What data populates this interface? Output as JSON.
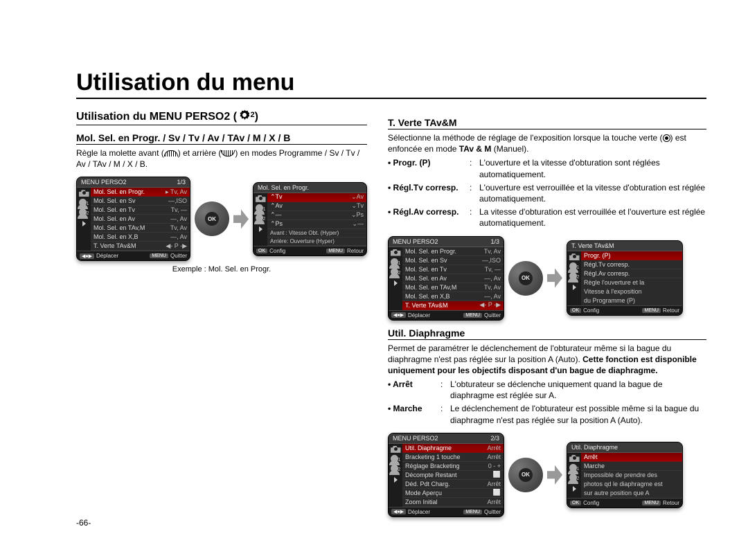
{
  "page_title": "Utilisation du menu",
  "page_number": "-66-",
  "left": {
    "section_title": "Utilisation du MENU PERSO2 (",
    "section_icon_sub": "2",
    "section_title_end": ")",
    "sub1_title": "Mol. Sel. en Progr. / Sv / Tv / Av / TAv / M / X / B",
    "sub1_desc": "Règle la molette avant (⌃) et arrière (⌄) en modes Programme / Sv / Tv / Av / TAv / M / X / B.",
    "caption": "Exemple : Mol. Sel. en Progr.",
    "panelA": {
      "title": "MENU PERSO2",
      "page": "1/3",
      "rows": [
        {
          "label": "Mol. Sel. en Progr.",
          "val": "▸ Tv, Av",
          "sel": true
        },
        {
          "label": "Mol. Sel. en Sv",
          "val": "—,ISO"
        },
        {
          "label": "Mol. Sel. en Tv",
          "val": "Tv, —"
        },
        {
          "label": "Mol. Sel. en Av",
          "val": "—, Av"
        },
        {
          "label": "Mol. Sel. en TAv,M",
          "val": "Tv, Av"
        },
        {
          "label": "Mol. Sel. en X,B",
          "val": "—, Av"
        },
        {
          "label": "T. Verte TAv&M",
          "val": "◀- P -▶"
        }
      ],
      "footer_left_icon": "◀●▶",
      "footer_left_txt": "Déplacer",
      "footer_right_icon": "MENU",
      "footer_right_txt": "Quitter"
    },
    "panelB": {
      "title": "Mol. Sel. en Progr.",
      "rows": [
        {
          "label": "⌃Tv",
          "val": "⌄Av",
          "sel": true
        },
        {
          "label": "⌃Av",
          "val": "⌄Tv"
        },
        {
          "label": "⌃—",
          "val": "⌄Ps"
        },
        {
          "label": "⌃Ps",
          "val": "⌄—"
        }
      ],
      "extra1": "Avant : Vitesse Obt. (Hyper)",
      "extra2": "Arrière: Ouverture (Hyper)",
      "footer_left_icon": "OK",
      "footer_left_txt": "Config",
      "footer_right_icon": "MENU",
      "footer_right_txt": "Retour"
    }
  },
  "right": {
    "sec1_title": "T. Verte TAv&M",
    "sec1_intro": "Sélectionne la méthode de réglage de l'exposition lorsque la touche verte (●) est enfoncée en mode TAv & M (Manuel).",
    "defs1": [
      {
        "term": "• Progr. (P)",
        "desc": "L'ouverture et la vitesse d'obturation sont réglées automatiquement."
      },
      {
        "term": "• Régl.Tv corresp.",
        "desc": "L'ouverture est verrouillée et la vitesse d'obturation est réglée automatiquement."
      },
      {
        "term": "• Régl.Av corresp.",
        "desc": "La vitesse d'obturation est verrouillée et l'ouverture est réglée automatiquement."
      }
    ],
    "panelC": {
      "title": "MENU PERSO2",
      "page": "1/3",
      "rows": [
        {
          "label": "Mol. Sel. en Progr.",
          "val": "Tv, Av"
        },
        {
          "label": "Mol. Sel. en Sv",
          "val": "—,ISO"
        },
        {
          "label": "Mol. Sel. en Tv",
          "val": "Tv, —"
        },
        {
          "label": "Mol. Sel. en Av",
          "val": "—, Av"
        },
        {
          "label": "Mol. Sel. en TAv,M",
          "val": "Tv, Av"
        },
        {
          "label": "Mol. Sel. en X,B",
          "val": "—, Av"
        },
        {
          "label": "T. Verte TAv&M",
          "val": "◀- P -▶",
          "sel": true
        }
      ],
      "footer_left_icon": "◀●▶",
      "footer_left_txt": "Déplacer",
      "footer_right_icon": "MENU",
      "footer_right_txt": "Quitter"
    },
    "panelD": {
      "title": "T. Verte TAv&M",
      "rows": [
        {
          "label": "Progr. (P)",
          "sel": true
        },
        {
          "label": "Régl.Tv corresp."
        },
        {
          "label": "Régl.Av corresp."
        }
      ],
      "note1": "Règle l'ouverture et la",
      "note2": "Vitesse à l'exposition",
      "note3": "du Programme (P)",
      "footer_left_icon": "OK",
      "footer_left_txt": "Config",
      "footer_right_icon": "MENU",
      "footer_right_txt": "Retour"
    },
    "sec2_title": "Util. Diaphragme",
    "sec2_intro_a": "Permet de paramétrer le déclenchement de l'obturateur même si la bague du diaphragme n'est pas réglée sur la position A (Auto). ",
    "sec2_intro_b": "Cette fonction est disponible uniquement pour les objectifs disposant d'un bague de diaphragme.",
    "defs2": [
      {
        "term": "• Arrêt",
        "desc": "L'obturateur se déclenche uniquement quand la bague de diaphragme est réglée sur A."
      },
      {
        "term": "• Marche",
        "desc": "Le déclenchement de l'obturateur est possible même si la bague du diaphragme n'est pas réglée sur la position A (Auto)."
      }
    ],
    "panelE": {
      "title": "MENU PERSO2",
      "page": "2/3",
      "rows": [
        {
          "label": "Util. Diaphragme",
          "val": "Arrêt",
          "sel": true
        },
        {
          "label": "Bracketing 1 touche",
          "val": "Arrêt"
        },
        {
          "label": "Réglage Bracketing",
          "val": "0 - +"
        },
        {
          "label": "Décompte Restant",
          "val": "⬜"
        },
        {
          "label": "Déd. Pdt Charg.",
          "val": "Arrêt"
        },
        {
          "label": "Mode Aperçu",
          "val": "⬜"
        },
        {
          "label": "Zoom Initial",
          "val": "Arrêt"
        }
      ],
      "footer_left_icon": "◀●▶",
      "footer_left_txt": "Déplacer",
      "footer_right_icon": "MENU",
      "footer_right_txt": "Quitter"
    },
    "panelF": {
      "title": "Util. Diaphragme",
      "rows": [
        {
          "label": "Arrêt",
          "sel": true
        },
        {
          "label": "Marche"
        }
      ],
      "note1": "Impossible de prendre des",
      "note2": "photos qd le diaphragme est",
      "note3": "sur autre position que A",
      "footer_left_icon": "OK",
      "footer_left_txt": "Config",
      "footer_right_icon": "MENU",
      "footer_right_txt": "Retour"
    }
  }
}
